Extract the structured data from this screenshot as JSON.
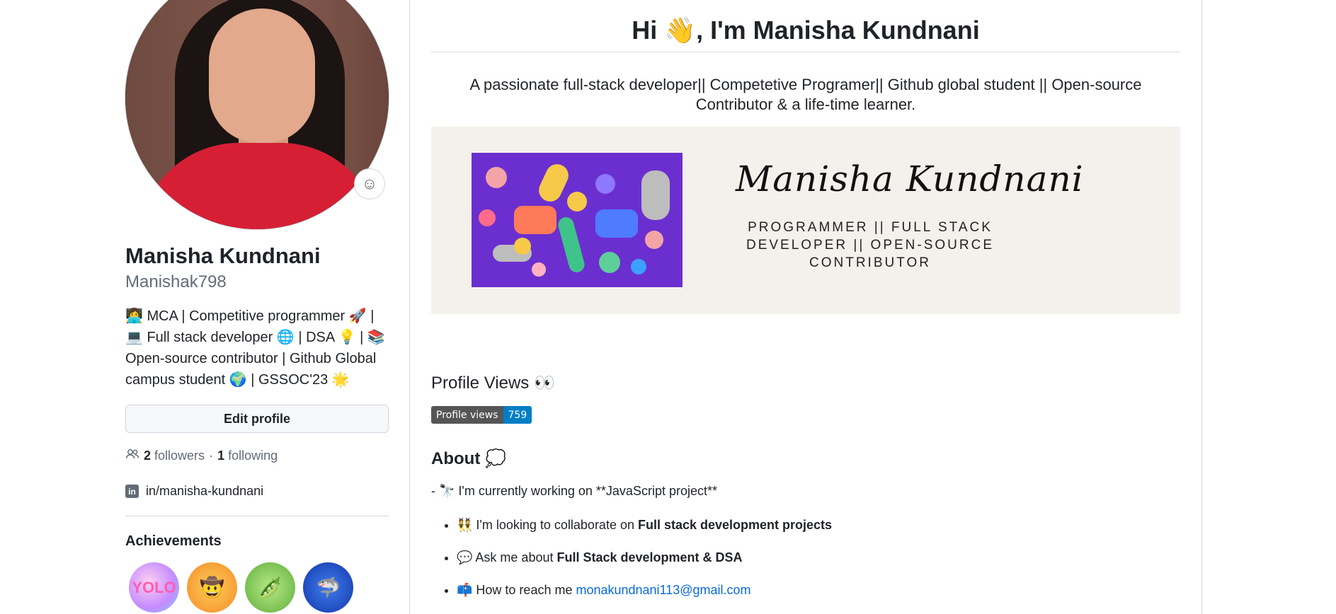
{
  "profile": {
    "name": "Manisha Kundnani",
    "login": "Manishak798",
    "bio_lines": [
      "👩‍💻 MCA | Competitive programmer 🚀 |",
      "💻 Full stack developer 🌐 | DSA 💡 | 📚",
      "Open-source contributor | Github Global",
      "campus student 🌍 | GSSOC'23 🌟"
    ],
    "edit_label": "Edit profile",
    "followers_count": "2",
    "followers_label": "followers",
    "separator": "·",
    "following_count": "1",
    "following_label": "following",
    "linkedin": "in/manisha-kundnani",
    "achievements_title": "Achievements",
    "status_icon": "smiley-icon"
  },
  "readme": {
    "title": "Hi 👋, I'm Manisha Kundnani",
    "tagline": "A passionate full-stack developer|| Competetive Programer|| Github global student || Open-source Contributor & a life-time learner.",
    "banner_name": "Manisha Kundnani",
    "banner_sub": "PROGRAMMER || FULL STACK DEVELOPER || OPEN-SOURCE CONTRIBUTOR",
    "views_heading": "Profile Views 👀",
    "views_badge_label": "Profile views",
    "views_badge_count": "759",
    "about_heading": "About 💭",
    "about_first": "- 🔭 I'm currently working on **JavaScript project**",
    "about_items": [
      {
        "prefix": "👯 I'm looking to collaborate on ",
        "bold": "Full stack development projects"
      },
      {
        "prefix": "💬 Ask me about ",
        "bold": "Full Stack development & DSA"
      },
      {
        "prefix": "📫 How to reach me ",
        "link": "monakundnani113@gmail.com"
      }
    ]
  },
  "colors": {
    "link": "#0969da",
    "banner_bg": "#f4f1ec",
    "banner_art": "#6b2fd0",
    "badge_label": "#555555",
    "badge_count": "#007ec6"
  }
}
